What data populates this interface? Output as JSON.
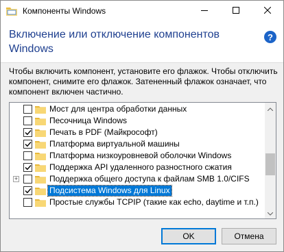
{
  "window": {
    "title": "Компоненты Windows",
    "controls": {
      "minimize_icon": "minimize-icon",
      "maximize_icon": "maximize-icon",
      "close_icon": "close-icon"
    }
  },
  "header": {
    "title": "Включение или отключение компонентов Windows",
    "help_label": "?"
  },
  "description": "Чтобы включить компонент, установите его флажок. Чтобы отключить компонент, снимите его флажок. Затененный флажок означает, что компонент включен частично.",
  "features": [
    {
      "label": "Мост для центра обработки данных",
      "checked": false,
      "expandable": false,
      "selected": false
    },
    {
      "label": "Песочница Windows",
      "checked": false,
      "expandable": false,
      "selected": false
    },
    {
      "label": "Печать в PDF (Майкрософт)",
      "checked": true,
      "expandable": false,
      "selected": false
    },
    {
      "label": "Платформа виртуальной машины",
      "checked": true,
      "expandable": false,
      "selected": false
    },
    {
      "label": "Платформа низкоуровневой оболочки Windows",
      "checked": false,
      "expandable": false,
      "selected": false
    },
    {
      "label": "Поддержка API удаленного разностного сжатия",
      "checked": true,
      "expandable": false,
      "selected": false
    },
    {
      "label": "Поддержка общего доступа к файлам SMB 1.0/CIFS",
      "checked": false,
      "expandable": true,
      "selected": false
    },
    {
      "label": "Подсистема Windows для Linux",
      "checked": true,
      "expandable": false,
      "selected": true
    },
    {
      "label": "Простые службы TCPIP (такие как echo, daytime и т.п.)",
      "checked": false,
      "expandable": false,
      "selected": false
    }
  ],
  "buttons": {
    "ok": "OK",
    "cancel": "Отмена"
  },
  "colors": {
    "accent": "#0078d7",
    "header_title": "#1e3f8f",
    "folder": "#f8d775"
  }
}
